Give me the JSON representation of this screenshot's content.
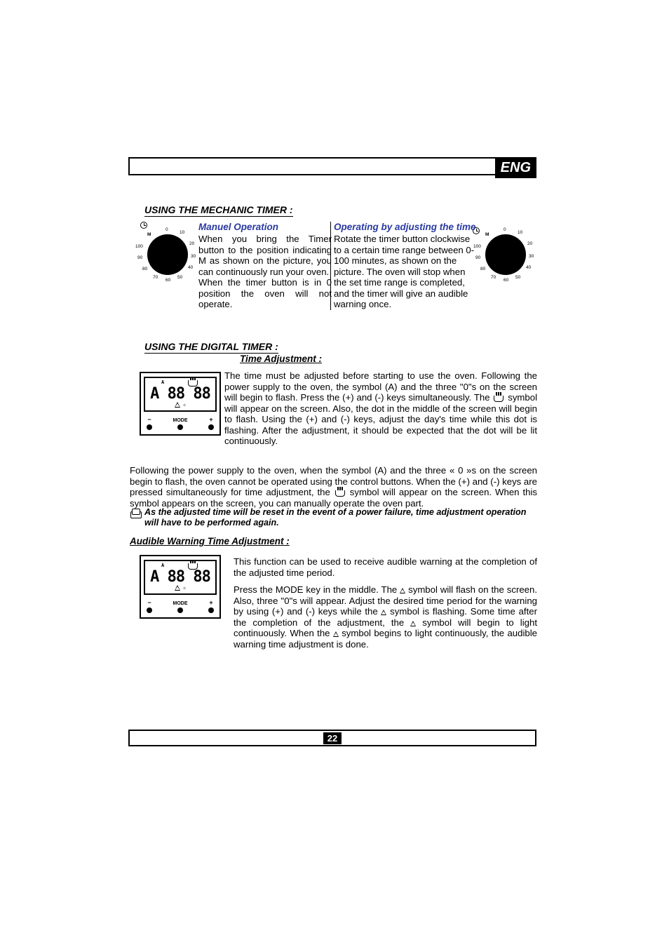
{
  "lang_badge": "ENG",
  "page_number": "22",
  "sec1_title": "USING THE MECHANIC TIMER :",
  "manual_title": "Manuel Operation",
  "adjust_title": "Operating by adjusting the time",
  "manual_text": "When you bring the Timer button to the position indicating M as shown on the picture, you can continuously run your oven.\nWhen the timer button is in 0 position the oven will not operate.",
  "adjust_text": "Rotate the timer button clockwise to a certain time range between 0-100 minutes, as shown on the picture. The oven will stop when the set time range is completed, and the timer will give an audible warning once.",
  "dial_ticks": [
    "0",
    "10",
    "20",
    "30",
    "40",
    "50",
    "60",
    "70",
    "80",
    "90",
    "100",
    "M"
  ],
  "sec3_title": "USING THE DIGITAL TIMER :",
  "time_adj_head": "Time Adjustment :",
  "time_adj_text": "The time must be adjusted before starting to use the oven. Following the power supply to the oven, the symbol (A) and the three \"0\"s on the screen will begin to flash. Press the (+) and (-) keys simultaneously. The [POT] symbol will appear on the screen. Also, the dot in the middle of the screen will begin to flash. Using the (+) and (-) keys, adjust the day's time while this dot is flashing. After the adjustment, it should be expected that the dot will be lit continuously.",
  "followup_text": "Following the power supply to the oven, when the symbol (A) and the three « 0 »s on the screen begin to flash, the oven cannot be operated using the control buttons. When the (+) and (-) keys are pressed simultaneously for time adjustment, the [POT] symbol will appear on the screen. When this symbol appears on the screen, you can manually operate the oven part.",
  "note_text": "As the adjusted time will be reset in the event of a power failure, time adjustment operation will have to be performed again.",
  "aud_head": "Audible Warning Time Adjustment :",
  "aud_text1": "This function can be used to receive audible warning at the completion of the adjusted time period.",
  "aud_text2": "Press the MODE key in the middle. The △ symbol will flash on the screen. Also, three \"0\"s will appear. Adjust the desired time period for the warning by using (+) and (-) keys while the △ symbol is flashing. Some time after the completion of the adjustment, the △ symbol will begin to light continuously. When the △ symbol begins to light continuously, the audible warning time adjustment is done.",
  "btn_minus": "−",
  "btn_plus": "+",
  "btn_mode": "MODE",
  "lcd_sample": "A 88 88",
  "lcd_icons": "▲"
}
